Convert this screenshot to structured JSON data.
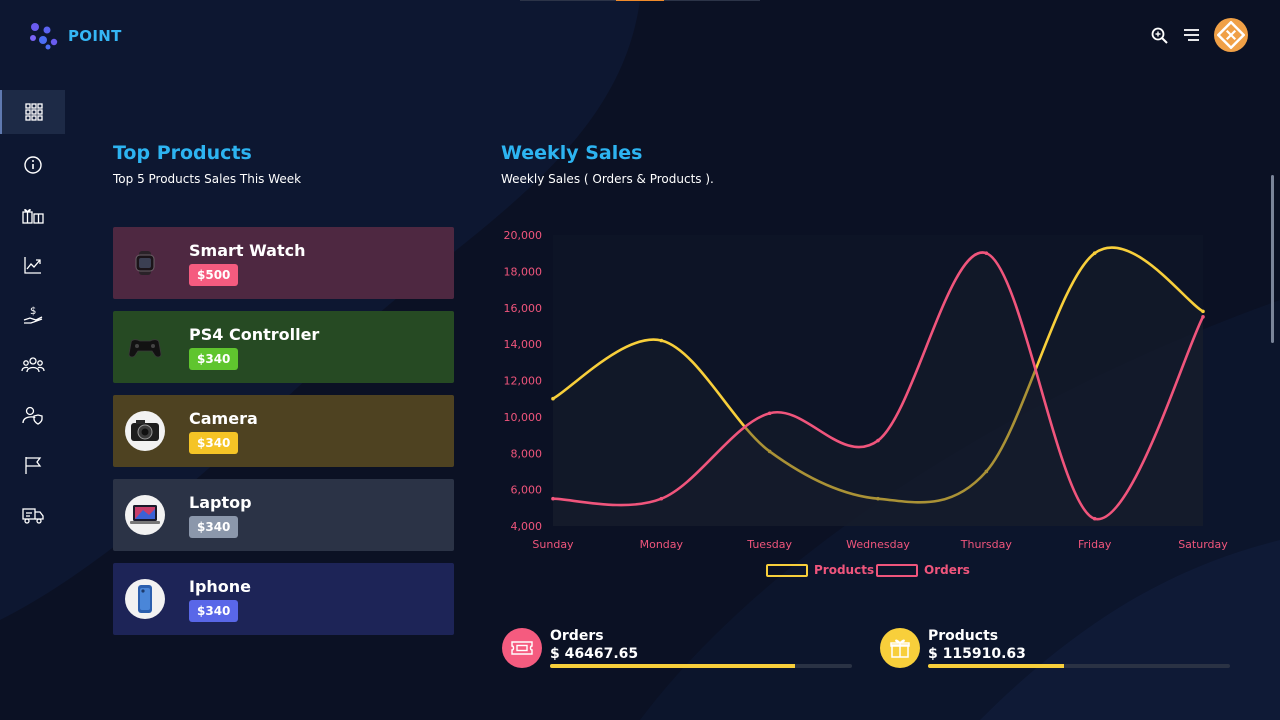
{
  "app": {
    "name": "POINT"
  },
  "header": {
    "icons": [
      "zoom-icon",
      "menu-icon"
    ],
    "avatar_icon": "brand-logo"
  },
  "sidebar": {
    "items": [
      {
        "icon": "grid-icon",
        "active": true
      },
      {
        "icon": "info-icon"
      },
      {
        "icon": "gifts-icon"
      },
      {
        "icon": "trend-icon"
      },
      {
        "icon": "dollar-hand-icon"
      },
      {
        "icon": "users-icon"
      },
      {
        "icon": "user-shield-icon"
      },
      {
        "icon": "flag-icon"
      },
      {
        "icon": "truck-icon"
      }
    ]
  },
  "top_products": {
    "title": "Top Products",
    "subtitle": "Top 5 Products Sales This Week",
    "items": [
      {
        "name": "Smart Watch",
        "price": "$500",
        "card_color": "#4e2841",
        "badge_color": "#f55b7f",
        "icon": "watch-icon"
      },
      {
        "name": "PS4 Controller",
        "price": "$340",
        "card_color": "#264a23",
        "badge_color": "#5fc52e",
        "icon": "gamepad-icon"
      },
      {
        "name": "Camera",
        "price": "$340",
        "card_color": "#4e4221",
        "badge_color": "#f5c426",
        "icon": "camera-icon"
      },
      {
        "name": "Laptop",
        "price": "$340",
        "card_color": "#2b3346",
        "badge_color": "#8b97ab",
        "icon": "laptop-icon"
      },
      {
        "name": "Iphone",
        "price": "$340",
        "card_color": "#1d2457",
        "badge_color": "#5967e8",
        "icon": "phone-icon"
      }
    ]
  },
  "weekly_sales": {
    "title": "Weekly Sales",
    "subtitle": "Weekly Sales ( Orders & Products )."
  },
  "chart_data": {
    "type": "line",
    "categories": [
      "Sunday",
      "Monday",
      "Tuesday",
      "Wednesday",
      "Thursday",
      "Friday",
      "Saturday"
    ],
    "ylim": [
      4000,
      20000
    ],
    "yticks": [
      "20,000",
      "18,000",
      "16,000",
      "14,000",
      "12,000",
      "10,000",
      "8,000",
      "6,000",
      "4,000"
    ],
    "ytick_values": [
      20000,
      18000,
      16000,
      14000,
      12000,
      10000,
      8000,
      6000,
      4000
    ],
    "grid": false,
    "legend_position": "bottom-center",
    "series": [
      {
        "name": "Products",
        "color": "#f8cf3b",
        "values": [
          11000,
          14200,
          8100,
          5500,
          7000,
          19000,
          15800
        ]
      },
      {
        "name": "Orders",
        "color": "#f0557c",
        "values": [
          5500,
          5500,
          10200,
          8700,
          19000,
          4400,
          15500
        ]
      }
    ]
  },
  "stats": [
    {
      "label": "Orders",
      "value": "$ 46467.65",
      "progress": 0.81,
      "icon": "ticket-icon",
      "icon_bg": "#f55b7f"
    },
    {
      "label": "Products",
      "value": "$ 115910.63",
      "progress": 0.45,
      "icon": "gift-icon",
      "icon_bg": "#f8cf3b"
    }
  ]
}
